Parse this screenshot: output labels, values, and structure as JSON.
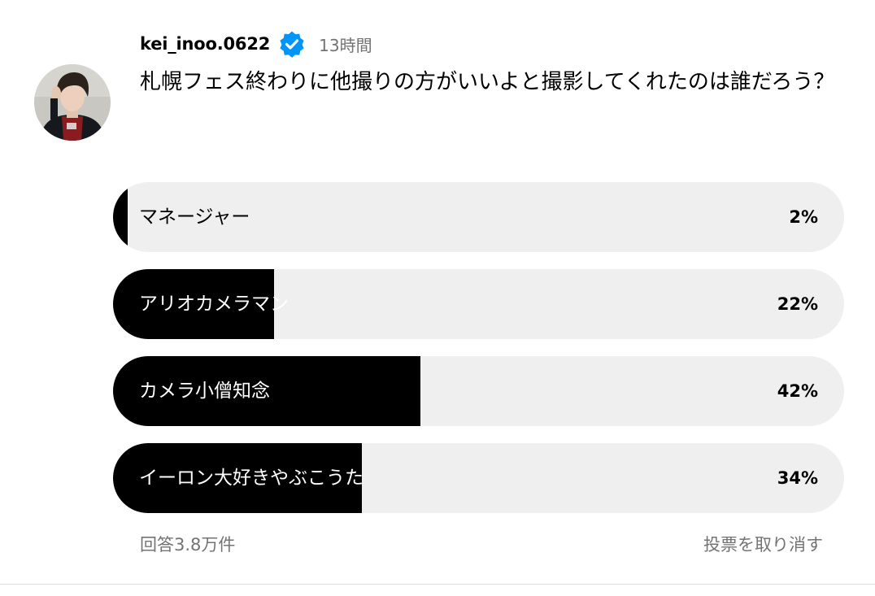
{
  "post": {
    "username": "kei_inoo.0622",
    "timestamp": "13時間",
    "question": "札幌フェス終わりに他撮りの方がいいよと撮影してくれたのは誰だろう？",
    "avatar_icon": "profile-photo",
    "verified_icon": "verified-badge-icon"
  },
  "poll": {
    "options": [
      {
        "label": "マネージャー",
        "percent_text": "2%",
        "percent": 2
      },
      {
        "label": "アリオカメラマン",
        "percent_text": "22%",
        "percent": 22
      },
      {
        "label": "カメラ小僧知念",
        "percent_text": "42%",
        "percent": 42
      },
      {
        "label": "イーロン大好きやぶこうた",
        "percent_text": "34%",
        "percent": 34
      }
    ],
    "response_count": "回答3.8万件",
    "undo_vote": "投票を取り消す"
  },
  "colors": {
    "fill": "#000000",
    "track": "#efefef",
    "muted_text": "#737373",
    "verified": "#0095f6"
  }
}
